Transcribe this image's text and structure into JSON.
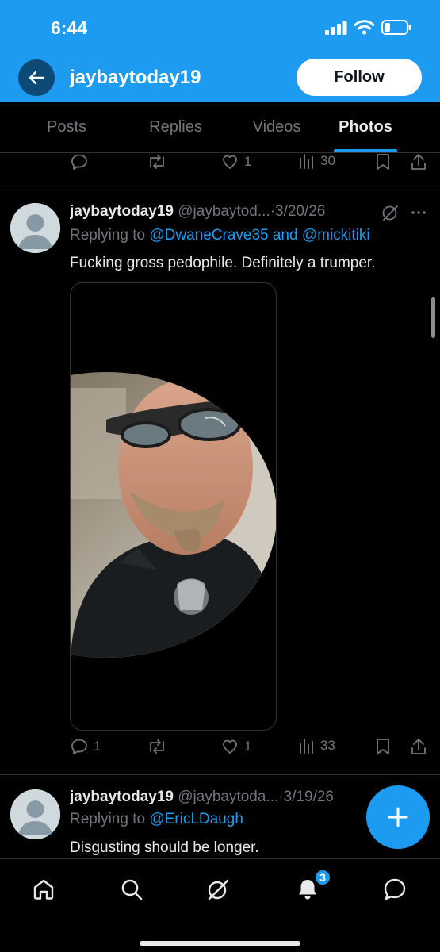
{
  "status_bar": {
    "time": "6:44"
  },
  "header": {
    "name": "jaybaytoday19",
    "follow_label": "Follow"
  },
  "tabs": [
    {
      "label": "Posts",
      "active": false
    },
    {
      "label": "Replies",
      "active": false
    },
    {
      "label": "Videos",
      "active": false
    },
    {
      "label": "Photos",
      "active": true
    }
  ],
  "prev_tweet_actions": {
    "replies": "",
    "reposts": "",
    "likes": "1",
    "views": "30"
  },
  "tweets": [
    {
      "name": "jaybaytoday19",
      "handle": "@jaybaytod...",
      "sep": "·",
      "date": "3/20/26",
      "replying_prefix": "Replying to ",
      "replying_to": "@DwaneCrave35 and @mickitiki",
      "text": "Fucking gross pedophile. Definitely a trumper.",
      "actions": {
        "replies": "1",
        "reposts": "",
        "likes": "1",
        "views": "33"
      }
    },
    {
      "name": "jaybaytoday19",
      "handle": "@jaybaytoda...",
      "sep": "·",
      "date": "3/19/26",
      "replying_prefix": "Replying to ",
      "replying_to": "@EricLDaugh",
      "text": "Disgusting should be longer."
    }
  ],
  "bottom_nav": {
    "notification_count": "3"
  },
  "colors": {
    "accent": "#1d9bf0",
    "background": "#000000",
    "text": "#e7e9ea",
    "muted": "#71767b",
    "border": "#2f3336"
  }
}
